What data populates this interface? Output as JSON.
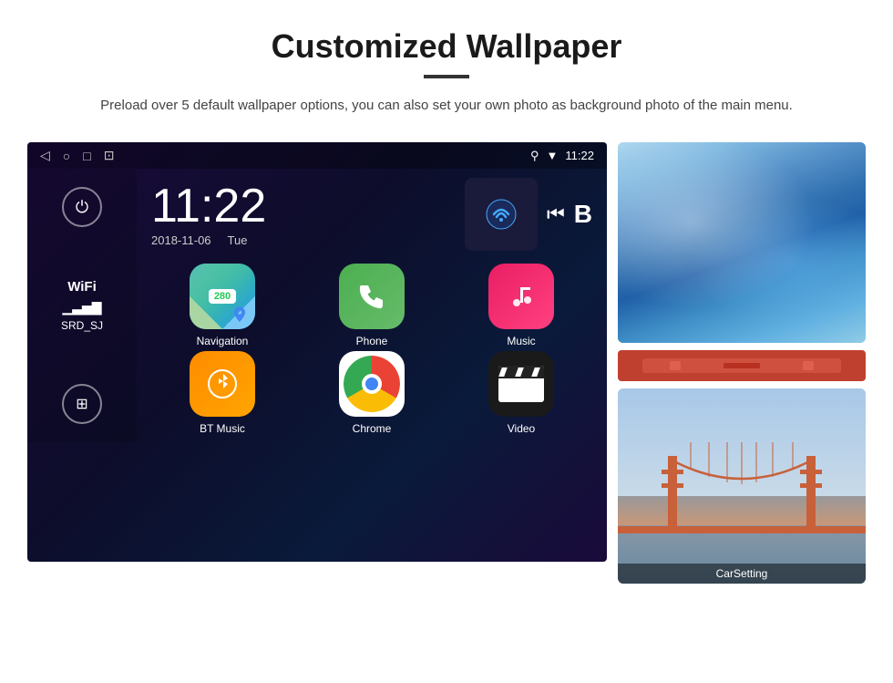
{
  "header": {
    "title": "Customized Wallpaper",
    "subtitle": "Preload over 5 default wallpaper options, you can also set your own photo as background photo of the main menu."
  },
  "android": {
    "time": "11:22",
    "date": "2018-11-06",
    "day": "Tue",
    "wifi_label": "WiFi",
    "wifi_network": "SRD_SJ",
    "status_time": "11:22",
    "apps": [
      {
        "id": "navigation",
        "label": "Navigation",
        "icon_type": "navigation"
      },
      {
        "id": "phone",
        "label": "Phone",
        "icon_type": "phone"
      },
      {
        "id": "music",
        "label": "Music",
        "icon_type": "music"
      },
      {
        "id": "btmusic",
        "label": "BT Music",
        "icon_type": "btmusic"
      },
      {
        "id": "chrome",
        "label": "Chrome",
        "icon_type": "chrome"
      },
      {
        "id": "video",
        "label": "Video",
        "icon_type": "video"
      }
    ]
  },
  "wallpapers": {
    "carsetting_label": "CarSetting"
  }
}
